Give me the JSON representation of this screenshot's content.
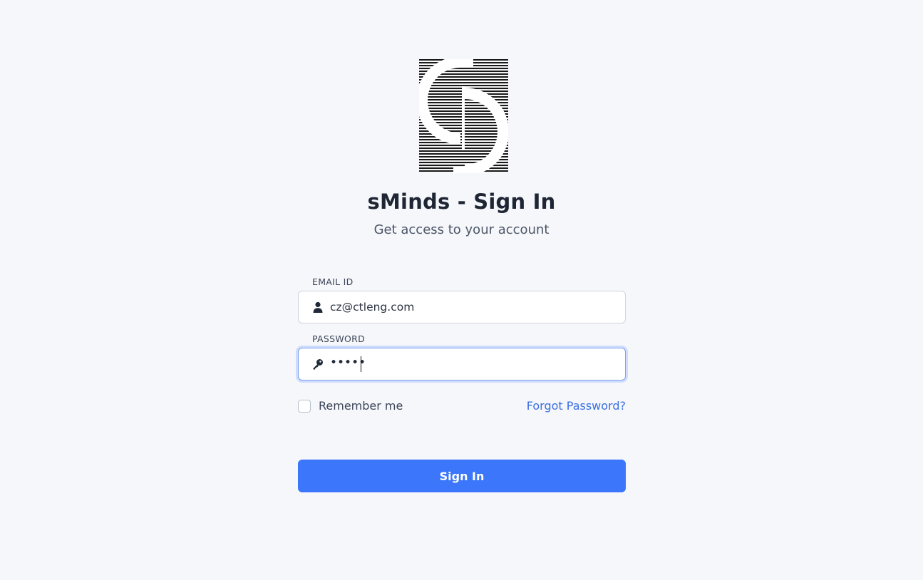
{
  "header": {
    "logo_name": "sminds-logo",
    "title": "sMinds - Sign In",
    "subtitle": "Get access to your account"
  },
  "form": {
    "email": {
      "label": "EMAIL ID",
      "value": "cz@ctleng.com",
      "icon": "user-icon"
    },
    "password": {
      "label": "PASSWORD",
      "masked_value": "•••••",
      "icon": "key-icon"
    },
    "remember_label": "Remember me",
    "remember_checked": false,
    "forgot_label": "Forgot Password?",
    "submit_label": "Sign In"
  },
  "colors": {
    "background": "#f5f7fb",
    "primary": "#3b76fb",
    "link": "#3b6fe0",
    "focus_ring": "#cfdcfb"
  }
}
